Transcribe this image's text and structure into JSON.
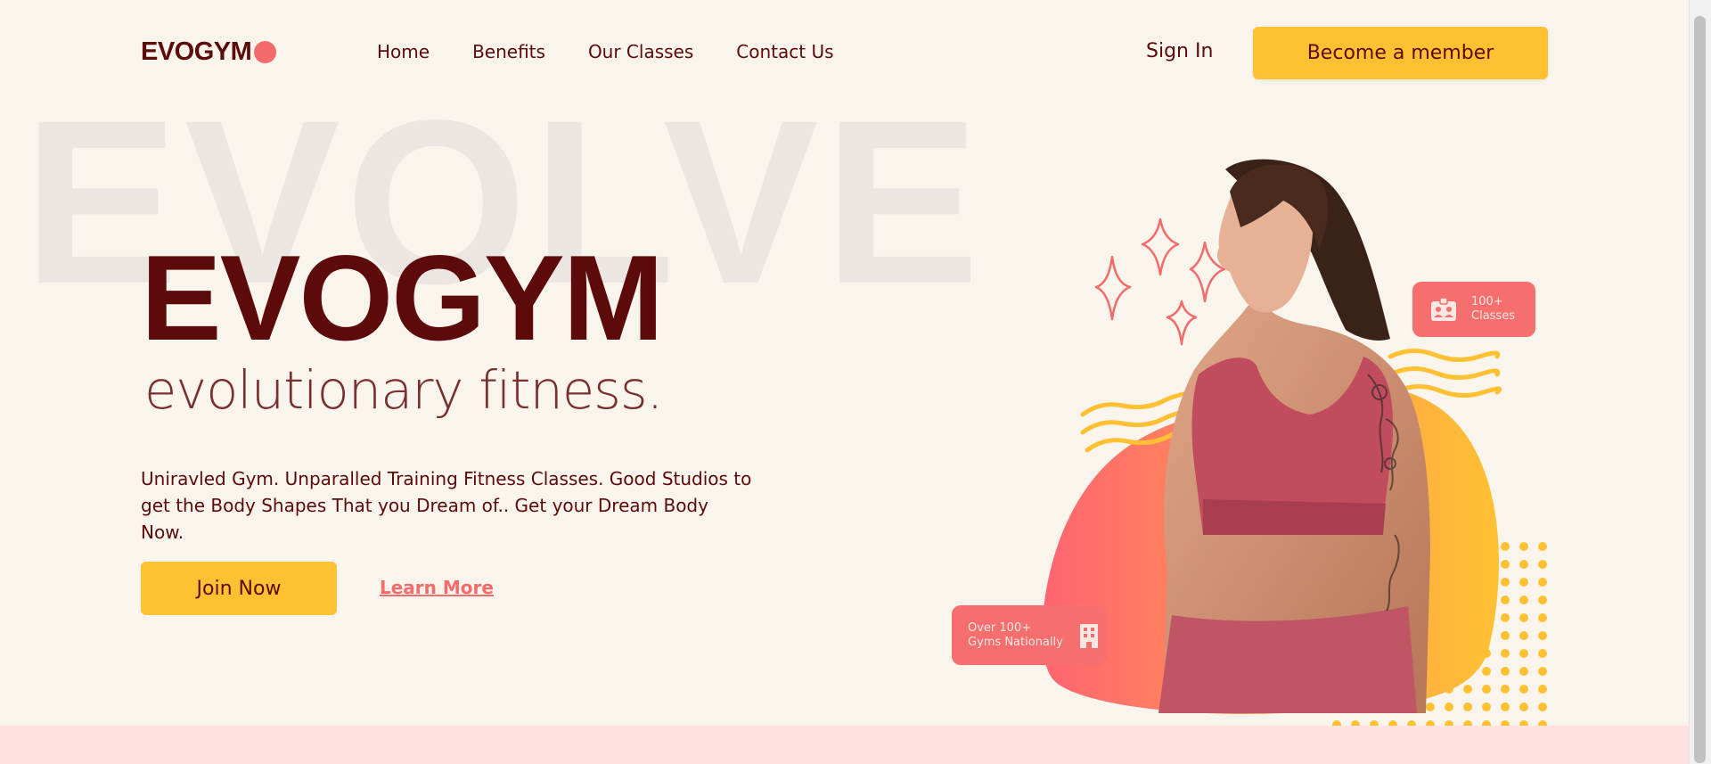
{
  "nav": {
    "logo_text": "EVOGYM",
    "links": [
      "Home",
      "Benefits",
      "Our Classes",
      "Contact Us"
    ],
    "sign_in": "Sign In",
    "cta": "Become a member"
  },
  "hero": {
    "background_word": "EVOLVE",
    "title": "EVOGYM",
    "subtitle": "evolutionary fitness.",
    "description": "Uniravled Gym. Unparalled Training Fitness Classes. Good Studios to get the Body Shapes That you Dream of.. Get your Dream Body Now.",
    "join_label": "Join Now",
    "learn_more_label": "Learn More"
  },
  "cards": {
    "classes": {
      "line1": "100+",
      "line2": "Classes",
      "icon": "id-card-icon"
    },
    "gyms": {
      "line1": "Over 100+",
      "line2": "Gyms Nationally",
      "icon": "building-icon"
    }
  },
  "colors": {
    "background": "#f9f4ec",
    "primary_text": "#5c0a0a",
    "accent_yellow": "#ffc132",
    "accent_coral": "#f66f6e",
    "bottom_strip": "#ffe1e0"
  }
}
